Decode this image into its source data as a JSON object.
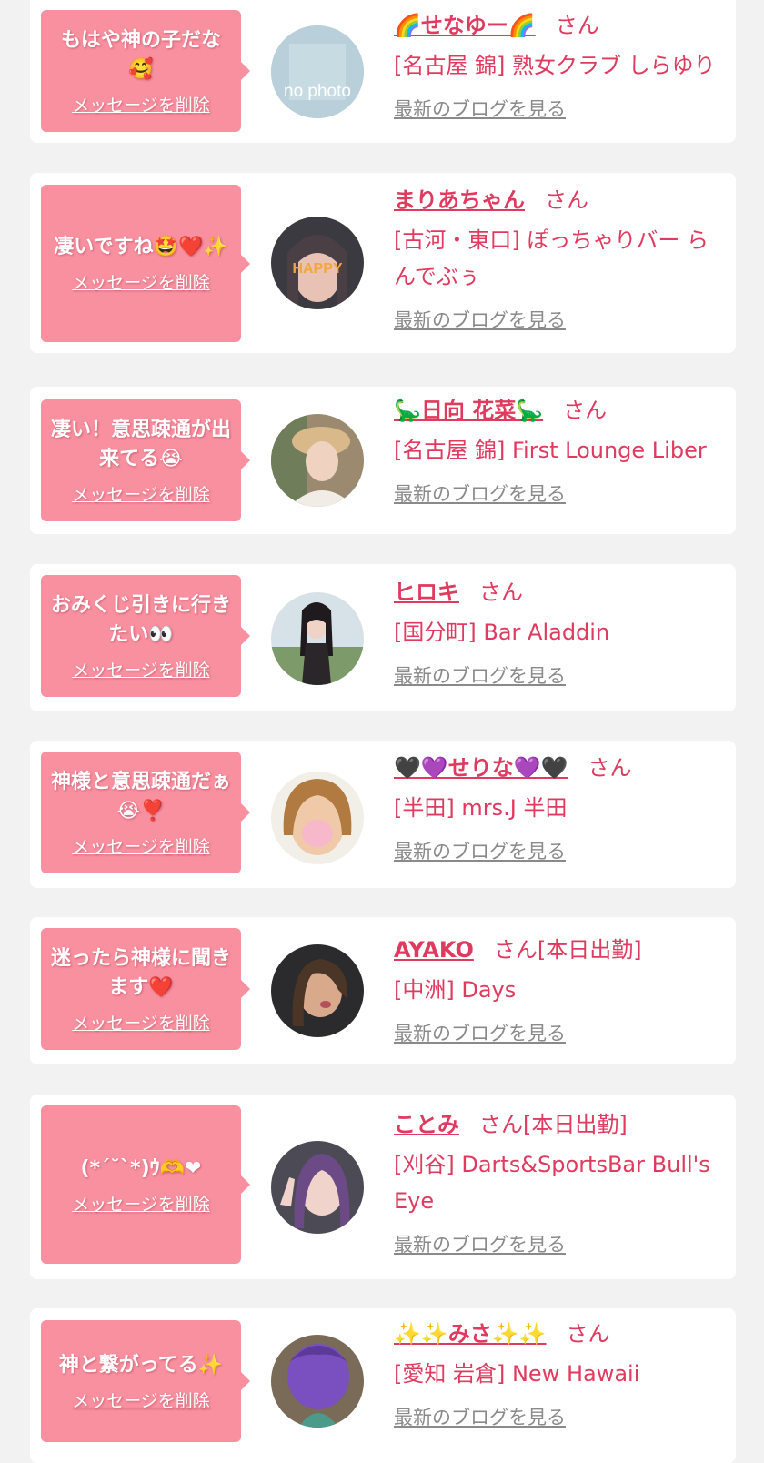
{
  "theme": {
    "bubble": "#f9909f",
    "accent": "#e03a5e",
    "link_gray": "#8a8a8a"
  },
  "entries": [
    {
      "message": "もはや神の子だな🥰",
      "delete_label": "メッセージを削除",
      "name": "🌈せなゆー🌈",
      "honorific": "さん",
      "status": "",
      "shop": "[名古屋 錦] 熟女クラブ しらゆり",
      "blog_label": "最新のブログを見る",
      "avatar_text": "no photo"
    },
    {
      "message": "凄いですね🤩❤️✨",
      "delete_label": "メッセージを削除",
      "name": "まりあちゃん",
      "honorific": "さん",
      "status": "",
      "shop": "[古河・東口] ぽっちゃりバー らんでぶぅ",
      "blog_label": "最新のブログを見る",
      "avatar_text": "HAPPY"
    },
    {
      "message": "凄い！意思疎通が出来てる😭",
      "delete_label": "メッセージを削除",
      "name": "🦕日向 花菜🦕",
      "honorific": "さん",
      "status": "",
      "shop": "[名古屋 錦] First Lounge Liber",
      "blog_label": "最新のブログを見る",
      "avatar_text": ""
    },
    {
      "message": "おみくじ引きに行きたい👀",
      "delete_label": "メッセージを削除",
      "name": "ヒロキ",
      "honorific": "さん",
      "status": "",
      "shop": "[国分町] Bar Aladdin",
      "blog_label": "最新のブログを見る",
      "avatar_text": ""
    },
    {
      "message": "神様と意思疎通だぁ😭❣️",
      "delete_label": "メッセージを削除",
      "name": "🖤💜せりな💜🖤",
      "honorific": "さん",
      "status": "",
      "shop": "[半田] mrs.J 半田",
      "blog_label": "最新のブログを見る",
      "avatar_text": ""
    },
    {
      "message": "迷ったら神様に聞きます❤️",
      "delete_label": "メッセージを削除",
      "name": "AYAKO",
      "honorific": "さん",
      "status": "[本日出勤]",
      "shop": "[中洲] Days",
      "blog_label": "最新のブログを見る",
      "avatar_text": ""
    },
    {
      "message": "(*´˘`*)ｳ🫶❤",
      "delete_label": "メッセージを削除",
      "name": "ことみ",
      "honorific": "さん",
      "status": "[本日出勤]",
      "shop": "[刈谷] Darts&SportsBar Bull's Eye",
      "blog_label": "最新のブログを見る",
      "avatar_text": ""
    },
    {
      "message": "神と繋がってる✨",
      "delete_label": "メッセージを削除",
      "name": "✨✨みさ✨✨",
      "honorific": "さん",
      "status": "",
      "shop": "[愛知 岩倉] New Hawaii",
      "blog_label": "最新のブログを見る",
      "avatar_text": ""
    }
  ]
}
